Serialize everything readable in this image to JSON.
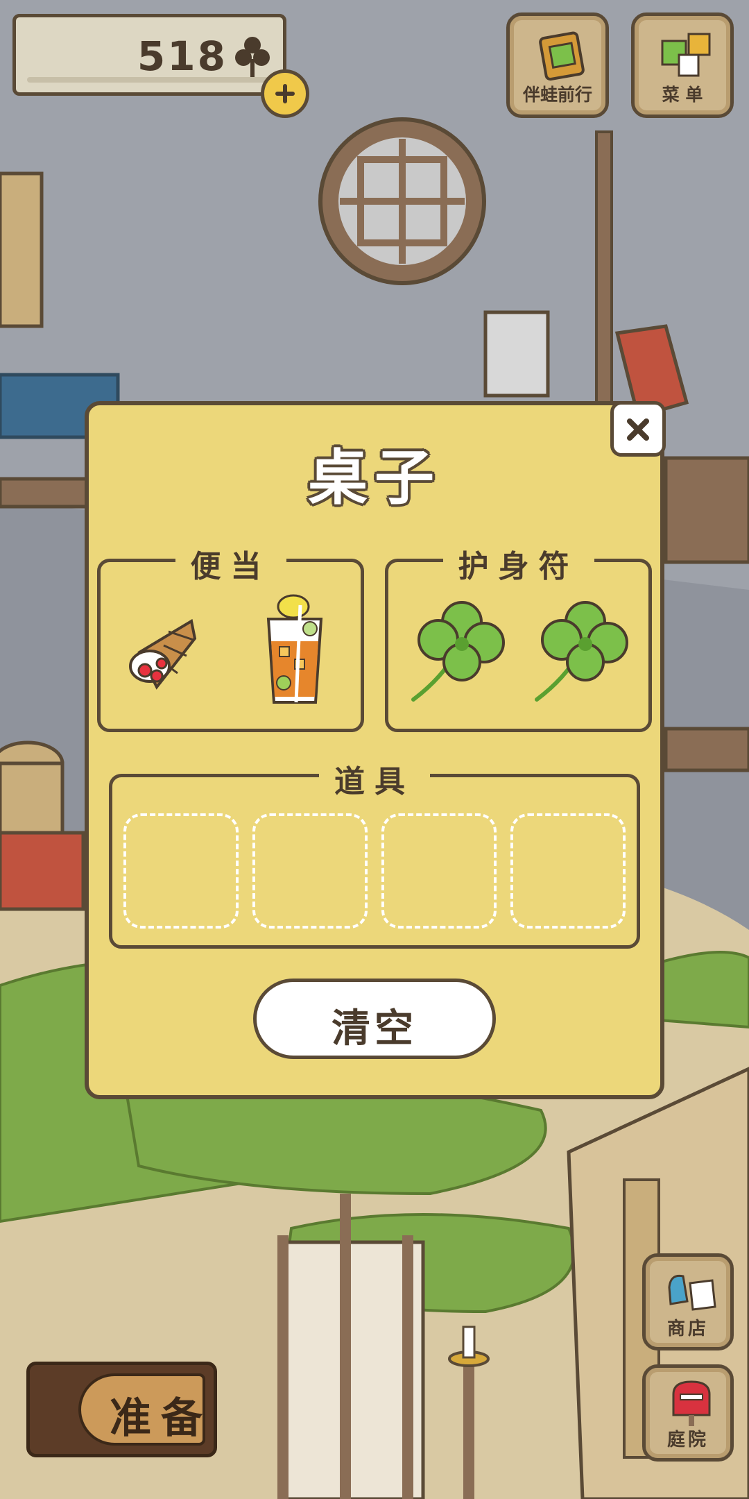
{
  "hud": {
    "clover_count": "518",
    "travel_button_label": "伴蛙前行",
    "menu_button_label": "菜 单",
    "shop_button_label": "商店",
    "yard_button_label": "庭院",
    "prepare_button_label": "准备"
  },
  "dialog": {
    "title": "桌子",
    "bento_label": "便当",
    "charm_label": "护身符",
    "items_label": "道具",
    "clear_button_label": "清空",
    "bento_items": [
      {
        "icon": "crepe-icon"
      },
      {
        "icon": "iced-tea-icon"
      }
    ],
    "charm_items": [
      {
        "icon": "four-leaf-clover-icon"
      },
      {
        "icon": "four-leaf-clover-icon"
      }
    ],
    "item_slots": 4
  },
  "colors": {
    "dialog_bg": "#ecd77a",
    "outline": "#5a4a36",
    "clover_green": "#7cc04a"
  }
}
